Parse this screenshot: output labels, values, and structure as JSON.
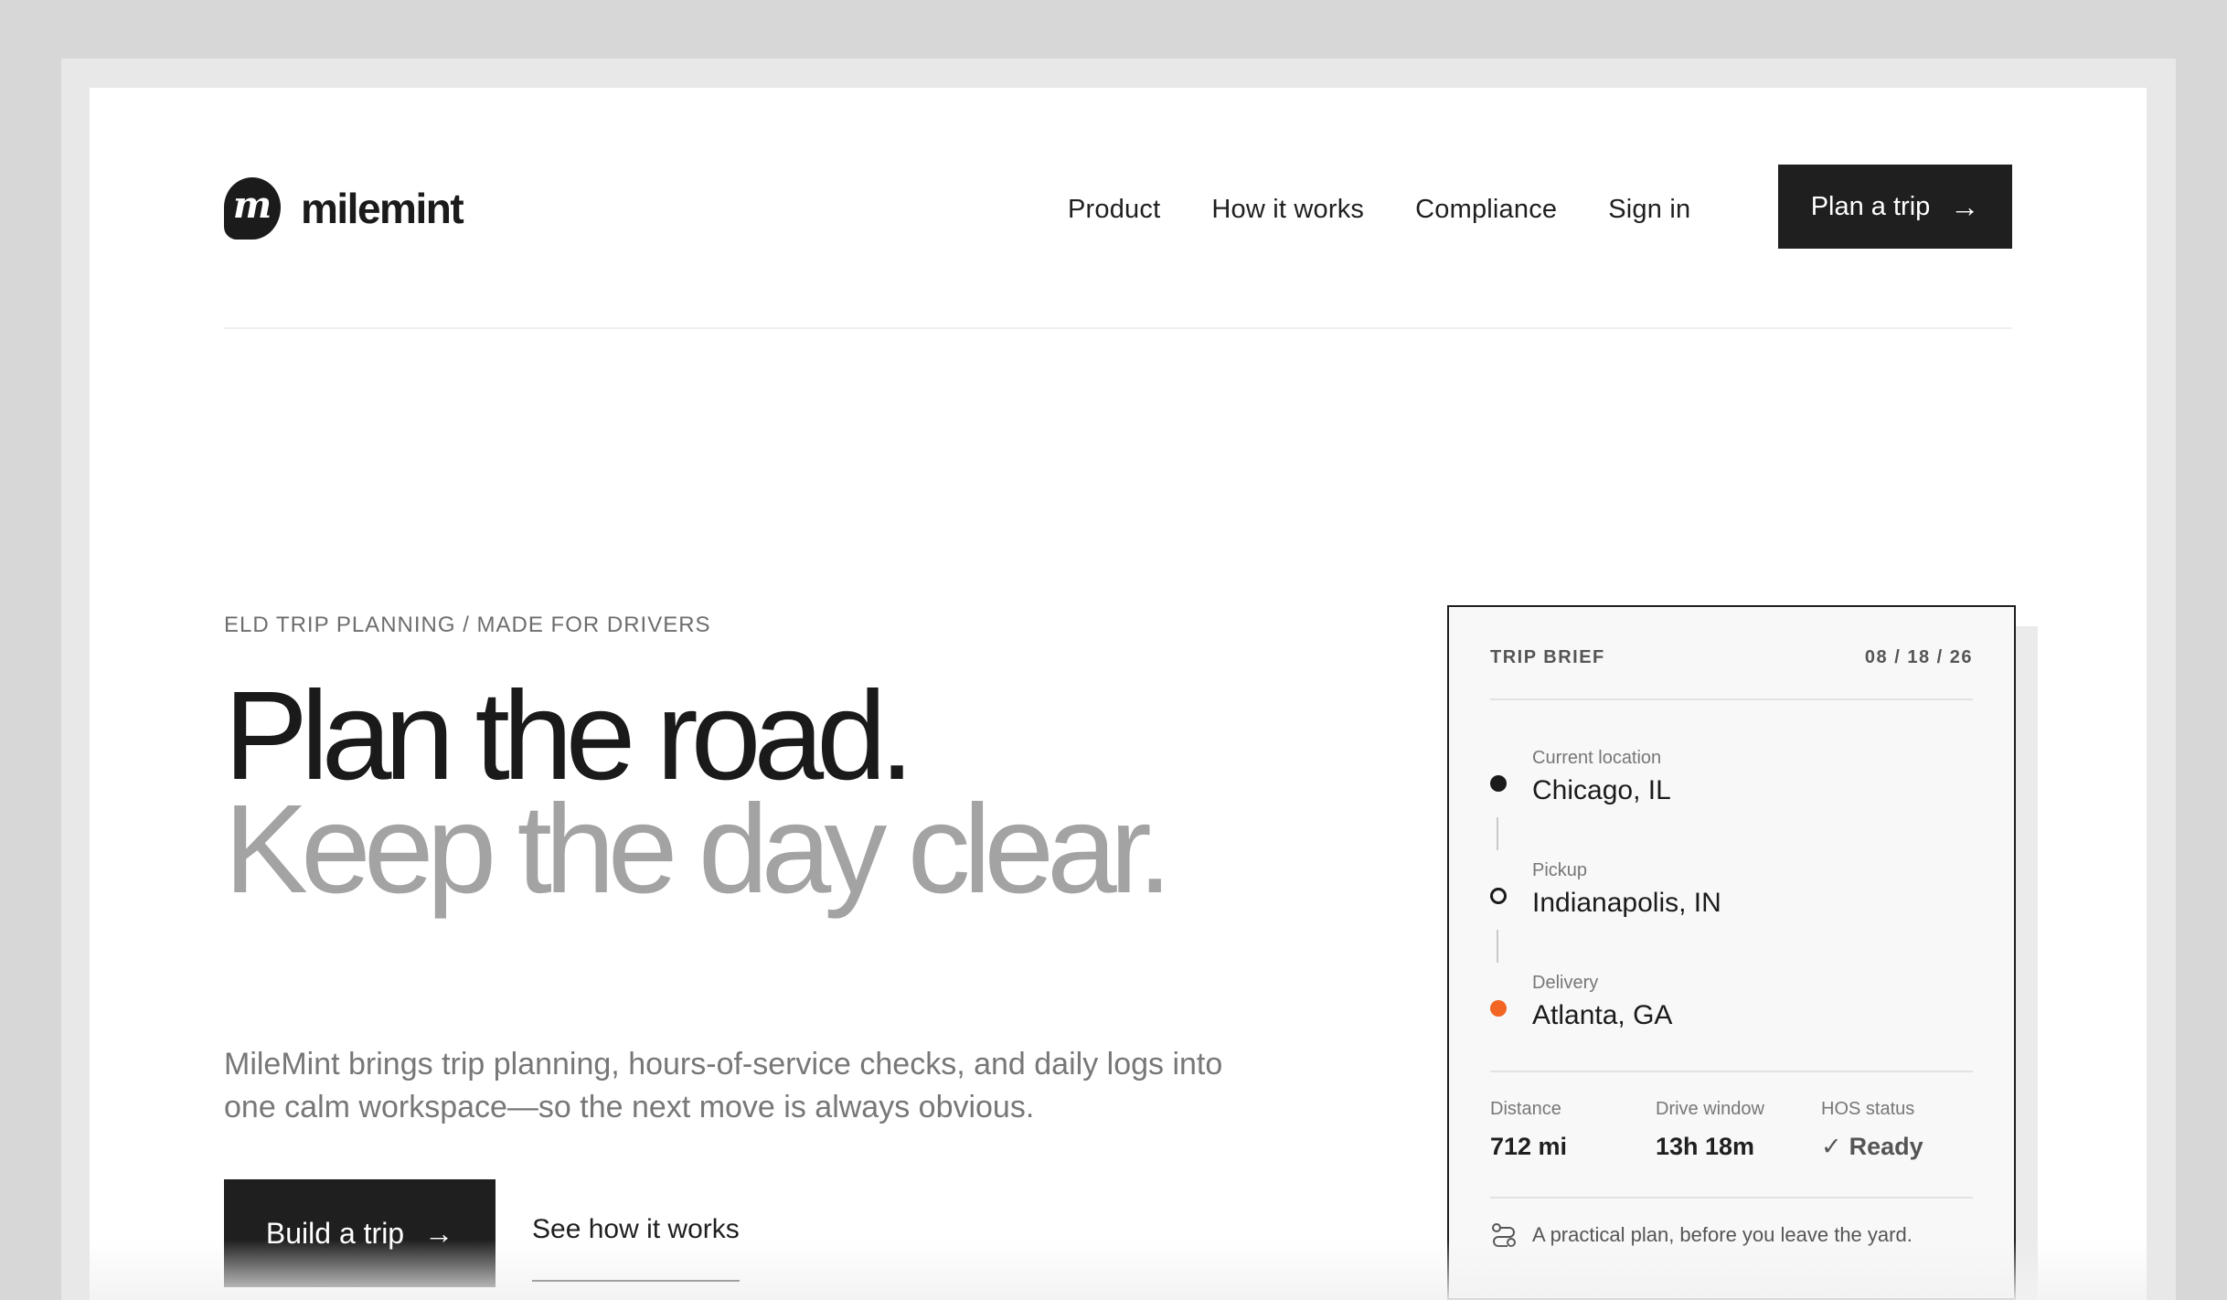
{
  "header": {
    "logo_text": "milemint",
    "logo_glyph": "m",
    "nav": [
      "Product",
      "How it works",
      "Compliance",
      "Sign in"
    ],
    "cta_label": "Plan a trip"
  },
  "hero": {
    "eyebrow": "ELD TRIP PLANNING / MADE FOR DRIVERS",
    "title_line1": "Plan the road.",
    "title_line2": "Keep the day clear.",
    "lede": "MileMint brings trip planning, hours-of-service checks, and daily logs into one calm workspace—so the next move is always obvious.",
    "primary_cta": "Build a trip",
    "secondary_cta": "See how it works"
  },
  "trip_brief": {
    "title": "TRIP BRIEF",
    "date": "08 / 18 / 26",
    "stops": [
      {
        "label": "Current location",
        "value": "Chicago, IL"
      },
      {
        "label": "Pickup",
        "value": "Indianapolis, IN"
      },
      {
        "label": "Delivery",
        "value": "Atlanta, GA"
      }
    ],
    "metrics": [
      {
        "label": "Distance",
        "value": "712 mi"
      },
      {
        "label": "Drive window",
        "value": "13h 18m"
      },
      {
        "label": "HOS status",
        "value": "Ready"
      }
    ],
    "footer": "A practical plan, before you leave the yard."
  },
  "colors": {
    "ink": "#1f1f1f",
    "muted_heading": "#a3a3a3",
    "accent_orange": "#f26522",
    "card_bg": "#f8f8f8"
  },
  "icons": {
    "arrow": "arrow-right-icon",
    "check": "check-icon",
    "route": "route-icon"
  }
}
